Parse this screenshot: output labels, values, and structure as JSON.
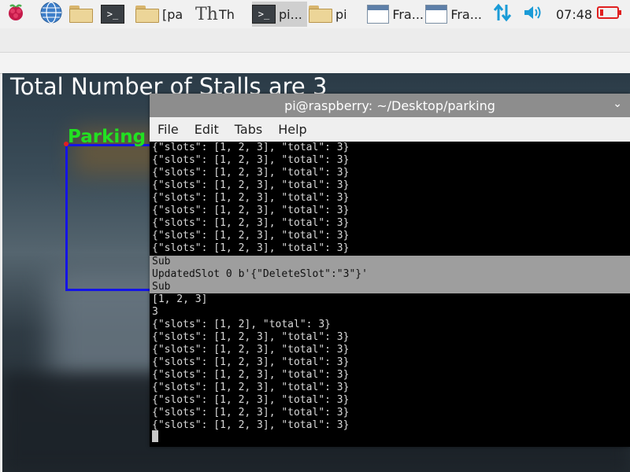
{
  "taskbar": {
    "items": [
      {
        "label": "[pa",
        "icon": "folder-icon"
      },
      {
        "label": "Th",
        "icon": "thonny-icon"
      },
      {
        "label": "pi...",
        "icon": "terminal-icon"
      },
      {
        "label": "pi",
        "icon": "folder-icon"
      },
      {
        "label": "Fra...",
        "icon": "frame-window-icon"
      },
      {
        "label": "Fra...",
        "icon": "frame-window-icon"
      }
    ],
    "clock": "07:48"
  },
  "camera": {
    "heading": "Total Number of Stalls are 3",
    "parking_label": "Parking"
  },
  "terminal": {
    "title": "pi@raspberry: ~/Desktop/parking",
    "menu": [
      "File",
      "Edit",
      "Tabs",
      "Help"
    ],
    "lines": [
      "{\"slots\": [1, 2, 3], \"total\": 3}",
      "{\"slots\": [1, 2, 3], \"total\": 3}",
      "{\"slots\": [1, 2, 3], \"total\": 3}",
      "{\"slots\": [1, 2, 3], \"total\": 3}",
      "{\"slots\": [1, 2, 3], \"total\": 3}",
      "{\"slots\": [1, 2, 3], \"total\": 3}",
      "{\"slots\": [1, 2, 3], \"total\": 3}",
      "{\"slots\": [1, 2, 3], \"total\": 3}",
      "{\"slots\": [1, 2, 3], \"total\": 3}",
      "Sub",
      "UpdatedSlot 0 b'{\"DeleteSlot\":\"3\"}'",
      "Sub",
      "[1, 2, 3]",
      "3",
      "{\"slots\": [1, 2], \"total\": 3}",
      "{\"slots\": [1, 2, 3], \"total\": 3}",
      "{\"slots\": [1, 2, 3], \"total\": 3}",
      "{\"slots\": [1, 2, 3], \"total\": 3}",
      "{\"slots\": [1, 2, 3], \"total\": 3}",
      "{\"slots\": [1, 2, 3], \"total\": 3}",
      "{\"slots\": [1, 2, 3], \"total\": 3}",
      "{\"slots\": [1, 2, 3], \"total\": 3}",
      "{\"slots\": [1, 2, 3], \"total\": 3}",
      "{\"slots\": [1, 2, 3], \"total\": 3}"
    ]
  },
  "colors": {
    "box": "#1414e6",
    "parking_text": "#22e022",
    "battery": "#e02020",
    "network": "#1a9bd7"
  }
}
